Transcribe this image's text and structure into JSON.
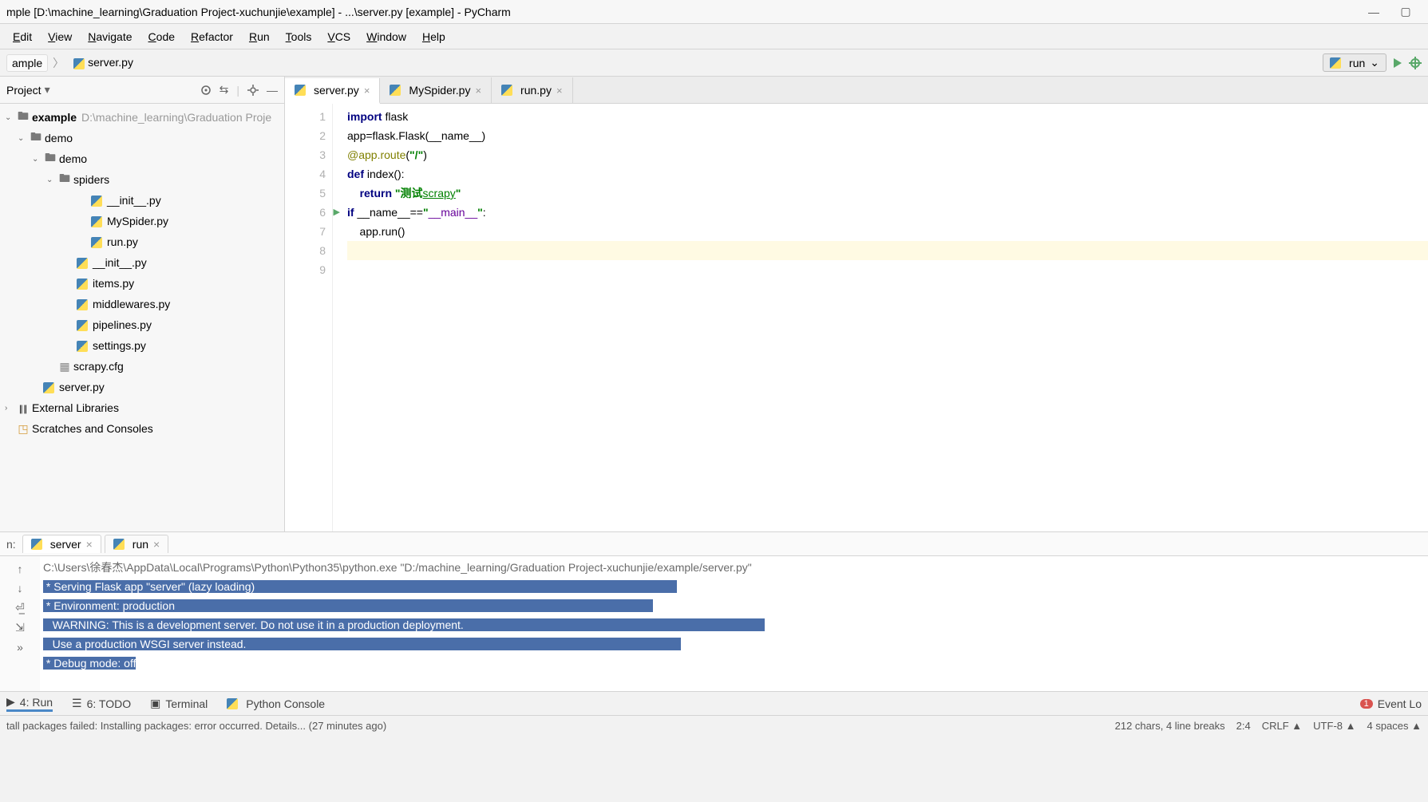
{
  "window": {
    "title": "mple [D:\\machine_learning\\Graduation Project-xuchunjie\\example] - ...\\server.py [example] - PyCharm"
  },
  "menu": {
    "items": [
      "Edit",
      "View",
      "Navigate",
      "Code",
      "Refactor",
      "Run",
      "Tools",
      "VCS",
      "Window",
      "Help"
    ],
    "accel": [
      "E",
      "V",
      "N",
      "C",
      "R",
      "R",
      "T",
      "V",
      "W",
      "H"
    ]
  },
  "breadcrumb": {
    "project": "ample",
    "file": "server.py"
  },
  "run_config": {
    "label": "run"
  },
  "project_tool": {
    "title": "Project"
  },
  "tree": {
    "root": {
      "name": "example",
      "path": "D:\\machine_learning\\Graduation Proje"
    },
    "nodes": [
      {
        "level": 1,
        "expand": true,
        "type": "folder",
        "name": "demo"
      },
      {
        "level": 2,
        "expand": true,
        "type": "folder",
        "name": "demo"
      },
      {
        "level": 3,
        "expand": true,
        "type": "folder",
        "name": "spiders"
      },
      {
        "level": 5,
        "type": "py",
        "name": "__init__.py"
      },
      {
        "level": 5,
        "type": "py",
        "name": "MySpider.py"
      },
      {
        "level": 5,
        "type": "py",
        "name": "run.py"
      },
      {
        "level": 4,
        "type": "py",
        "name": "__init__.py"
      },
      {
        "level": 4,
        "type": "py",
        "name": "items.py"
      },
      {
        "level": 4,
        "type": "py",
        "name": "middlewares.py"
      },
      {
        "level": 4,
        "type": "py",
        "name": "pipelines.py"
      },
      {
        "level": 4,
        "type": "py",
        "name": "settings.py"
      },
      {
        "level": 3,
        "type": "file",
        "name": "scrapy.cfg"
      },
      {
        "level": 2,
        "type": "py",
        "name": "server.py"
      }
    ],
    "external": "External Libraries",
    "scratches": "Scratches and Consoles"
  },
  "tabs": [
    {
      "name": "server.py",
      "active": true
    },
    {
      "name": "MySpider.py",
      "active": false
    },
    {
      "name": "run.py",
      "active": false
    }
  ],
  "code": {
    "lines": [
      {
        "n": 1,
        "t": "import",
        "sp": " flask"
      },
      {
        "n": 2,
        "t": "plain",
        "raw": "app=flask.Flask(__name__)"
      },
      {
        "n": 3,
        "t": "dec",
        "raw": "@app.route(\"/\")"
      },
      {
        "n": 4,
        "t": "def",
        "raw": "def index():"
      },
      {
        "n": 5,
        "t": "ret",
        "pre": "    return ",
        "s1": "\"测试",
        "link": "scrapy",
        "s2": "\""
      },
      {
        "n": 6,
        "t": "if",
        "raw": "if __name__==\"__main__\":"
      },
      {
        "n": 7,
        "t": "plain",
        "raw": "    app.run()"
      },
      {
        "n": 8,
        "t": "cur",
        "raw": ""
      },
      {
        "n": 9,
        "t": "plain",
        "raw": ""
      }
    ]
  },
  "run_tool": {
    "label": "n:",
    "tabs": [
      {
        "name": "server",
        "active": true
      },
      {
        "name": "run",
        "active": false
      }
    ],
    "console": [
      {
        "cls": "cmd",
        "text": "C:\\Users\\徐春杰\\AppData\\Local\\Programs\\Python\\Python35\\python.exe \"D:/machine_learning/Graduation Project-xuchunjie/example/server.py\""
      },
      {
        "cls": "sel",
        "text": " * Serving Flask app \"server\" (lazy loading)"
      },
      {
        "cls": "sel",
        "text": " * Environment: production"
      },
      {
        "cls": "sel",
        "text": "   WARNING: This is a development server. Do not use it in a production deployment."
      },
      {
        "cls": "sel",
        "text": "   Use a production WSGI server instead."
      },
      {
        "cls": "seltrail",
        "text": " * Debug mode: off"
      }
    ]
  },
  "tool_windows": {
    "run": "4: Run",
    "todo": "6: TODO",
    "terminal": "Terminal",
    "python_console": "Python Console",
    "event_log": "Event Lo",
    "event_count": "1"
  },
  "status": {
    "left": "tall packages failed: Installing packages: error occurred. Details... (27 minutes ago)",
    "chars": "212 chars, 4 line breaks",
    "pos": "2:4",
    "le": "CRLF ▲",
    "enc": "UTF-8 ▲",
    "indent": "4 spaces ▲"
  }
}
